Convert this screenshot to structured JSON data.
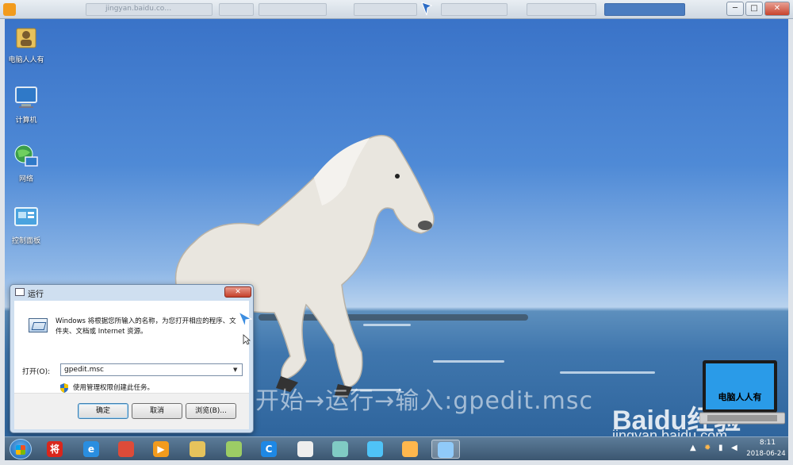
{
  "player": {
    "tabs": [
      {
        "label": "jingyan.baidu.co…"
      },
      {
        "label": ""
      },
      {
        "label": ""
      },
      {
        "label": ""
      },
      {
        "label": ""
      },
      {
        "label": ""
      }
    ],
    "min_label": "─",
    "max_label": "□",
    "close_label": "✕"
  },
  "desktop": {
    "icons": [
      {
        "label": "电脑人人有",
        "icon": "folder-user-icon"
      },
      {
        "label": "计算机",
        "icon": "computer-icon"
      },
      {
        "label": "网络",
        "icon": "network-icon"
      },
      {
        "label": "控制面板",
        "icon": "control-panel-icon"
      }
    ],
    "watermark": "开始→运行→输入:gpedit.msc",
    "baidu_logo": "Baidu经验",
    "baidu_url": "jingyan.baidu.com",
    "laptop_caption": "电脑人人有"
  },
  "run_dialog": {
    "title": "运行",
    "close_label": "✕",
    "description": "Windows 将根据您所输入的名称，为您打开相应的程序、文件夹、文档或 Internet 资源。",
    "open_label": "打开(O):",
    "open_value": "gpedit.msc",
    "admin_text": "使用管理权限创建此任务。",
    "ok_label": "确定",
    "cancel_label": "取消",
    "browse_label": "浏览(B)..."
  },
  "taskbar": {
    "apps": [
      {
        "name": "jiang-app-icon",
        "color": "#d9261c",
        "text": "将"
      },
      {
        "name": "ie-icon",
        "color": "#2a8ee0",
        "text": "e"
      },
      {
        "name": "chrome-icon",
        "color": "#dd4b39",
        "text": ""
      },
      {
        "name": "media-player-icon",
        "color": "#f29b1d",
        "text": "▶"
      },
      {
        "name": "explorer-icon",
        "color": "#e6c35c",
        "text": ""
      },
      {
        "name": "folder-icon",
        "color": "#9ccc65",
        "text": ""
      },
      {
        "name": "browser-icon",
        "color": "#1e88e5",
        "text": "C"
      },
      {
        "name": "document-icon",
        "color": "#eeeeee",
        "text": ""
      },
      {
        "name": "settings-icon",
        "color": "#80cbc4",
        "text": ""
      },
      {
        "name": "control-panel-icon",
        "color": "#4fc3f7",
        "text": ""
      },
      {
        "name": "paint-icon",
        "color": "#ffb74d",
        "text": ""
      },
      {
        "name": "run-icon",
        "color": "#90caf9",
        "text": ""
      }
    ],
    "tray_up_arrow": "▲",
    "time": "8:11",
    "date": "2018-06-24"
  }
}
